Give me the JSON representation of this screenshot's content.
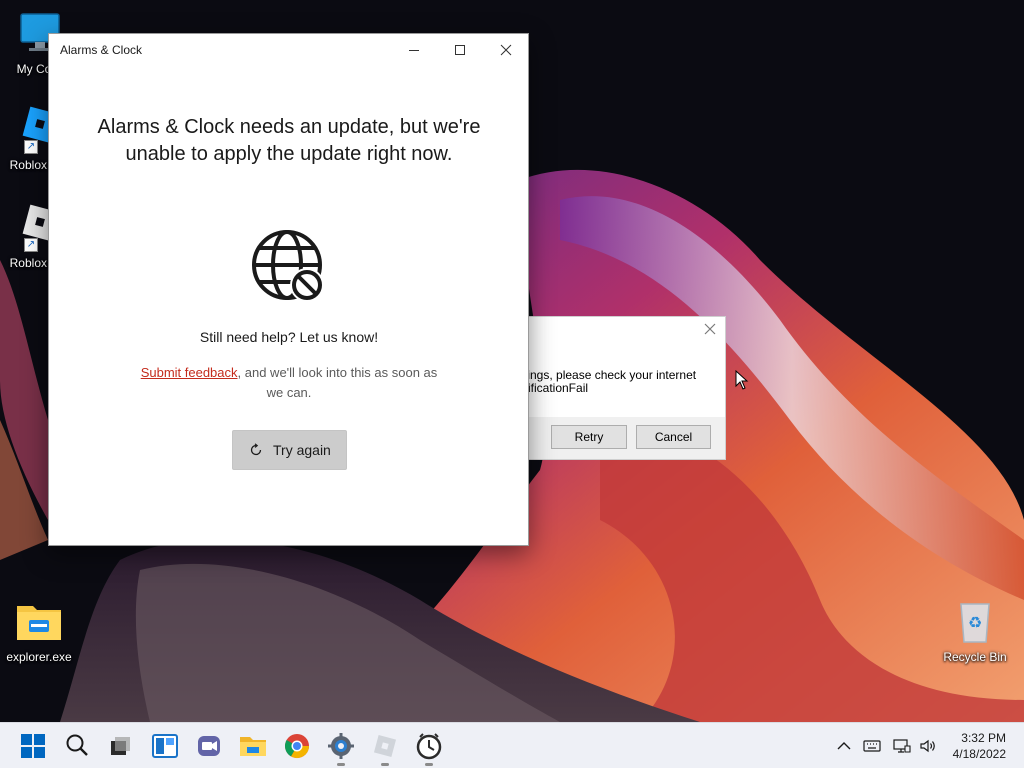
{
  "desktop": {
    "icons": [
      {
        "name": "my-computer",
        "label": "My Com"
      },
      {
        "name": "roblox-studio",
        "label": "Roblox S"
      },
      {
        "name": "roblox-player",
        "label": "Roblox P"
      },
      {
        "name": "explorer-exe",
        "label": "explorer.exe"
      },
      {
        "name": "recycle-bin",
        "label": "Recycle Bin"
      }
    ]
  },
  "background_dialog": {
    "message_line1": "tings, please check your internet",
    "message_line2": "rificationFail",
    "retry_label": "Retry",
    "cancel_label": "Cancel"
  },
  "window": {
    "title": "Alarms & Clock",
    "headline": "Alarms & Clock needs an update, but we're unable to apply the update right now.",
    "help_text": "Still need help? Let us know!",
    "feedback_link": "Submit feedback",
    "feedback_rest": ", and we'll look into this as soon as we can.",
    "try_again_label": "Try again"
  },
  "taskbar": {
    "time": "3:32 PM",
    "date": "4/18/2022"
  },
  "colors": {
    "link": "#c42b1c",
    "accent": "#0067c0",
    "taskbar": "#eef0f6"
  }
}
